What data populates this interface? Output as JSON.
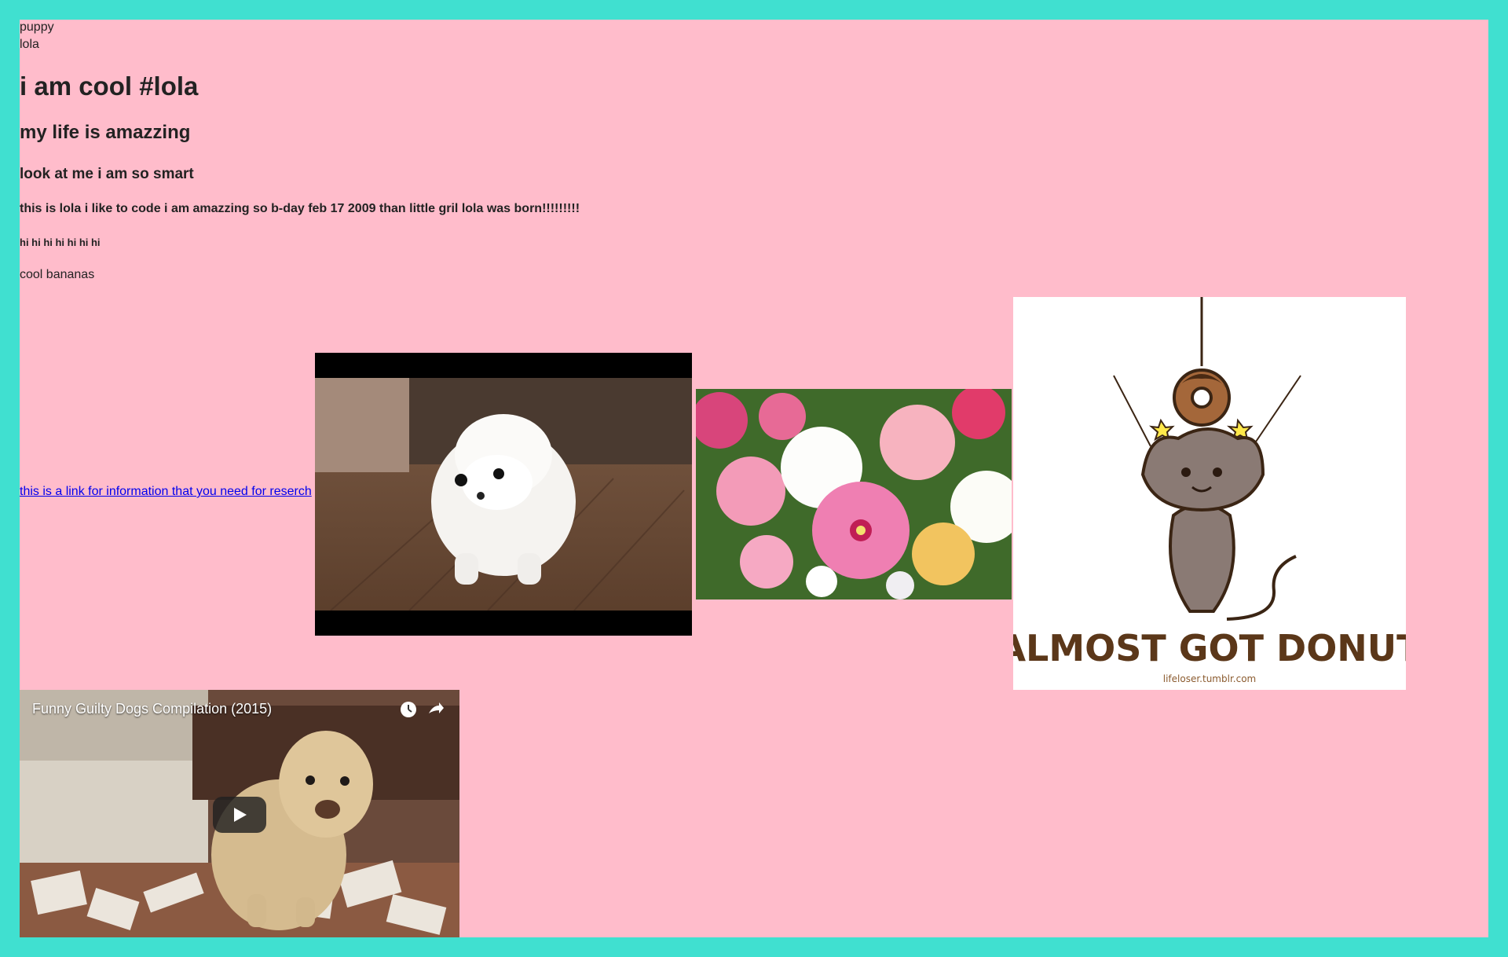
{
  "text": {
    "line1": "puppy",
    "line2": "lola",
    "h1": "i am cool #lola",
    "h2": "my life is amazzing",
    "h3": "look at me i am so smart",
    "h4": "this is lola i like to code i am amazzing so b-day feb 17 2009 than little gril lola was born!!!!!!!!!",
    "h5": "hi hi hi hi hi hi hi",
    "p": "cool bananas"
  },
  "link": {
    "label": "this is a link for information that you need for reserch"
  },
  "images": {
    "cat": {
      "caption": "ALMOST GOT DONUT",
      "credit": "lifeloser.tumblr.com"
    }
  },
  "video": {
    "title": "Funny Guilty Dogs Compilation (2015)",
    "icons": [
      "clock-icon",
      "share-icon",
      "play-icon"
    ]
  },
  "colors": {
    "border": "#40e0d0",
    "page_bg": "#ffbccb",
    "link": "#0000ee"
  }
}
